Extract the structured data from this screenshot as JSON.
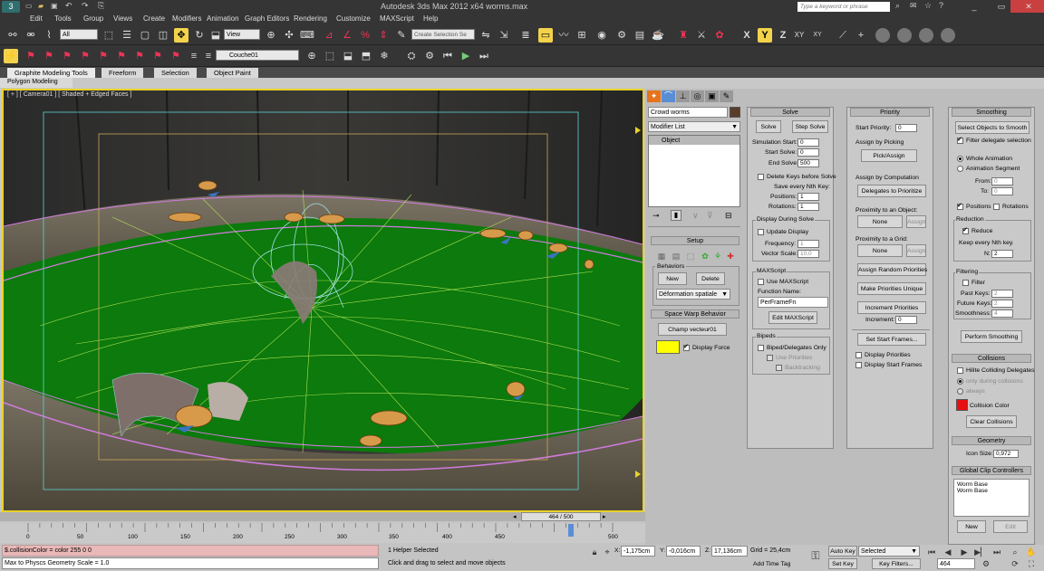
{
  "title_bar": {
    "title": "Autodesk 3ds Max  2012 x64      worms.max",
    "search_placeholder": "Type a keyword or phrase"
  },
  "menu": [
    "Edit",
    "Tools",
    "Group",
    "Views",
    "Create",
    "Modifiers",
    "Animation",
    "Graph Editors",
    "Rendering",
    "Customize",
    "MAXScript",
    "Help"
  ],
  "toolbar": {
    "filter_value": "All",
    "view_value": "View",
    "layer_value": "Couche01",
    "selection_set_placeholder": "Create Selection Se",
    "axis_x": "X",
    "axis_y": "Y",
    "axis_z": "Z",
    "axis_xy": "XY",
    "axis_xy2": "XY"
  },
  "ribbon": {
    "tabs": [
      "Graphite Modeling Tools",
      "Freeform",
      "Selection",
      "Object Paint"
    ],
    "sub_label": "Polygon Modeling"
  },
  "viewport": {
    "label": "[ + ] [ Camera01 ] [ Shaded + Edged Faces ]"
  },
  "modify": {
    "object_name": "Crowd worms",
    "modifier_list": "Modifier List",
    "stack_item": "Object"
  },
  "setup": {
    "header": "Setup",
    "behaviors_label": "Behaviors",
    "new": "New",
    "delete": "Delete",
    "behavior_value": "Déformation spatiale",
    "swb_header": "Space Warp Behavior",
    "swb_button": "Champ vecteur01",
    "display_force": "Display Force",
    "swatch_color": "#ffff00"
  },
  "solve": {
    "header": "Solve",
    "solve": "Solve",
    "step_solve": "Step Solve",
    "sim_start_label": "Simulation Start:",
    "sim_start": "0",
    "start_solve_label": "Start Solve:",
    "start_solve": "0",
    "end_solve_label": "End Solve:",
    "end_solve": "500",
    "delete_keys": "Delete Keys before Solve",
    "save_every": "Save every Nth Key:",
    "positions_label": "Positions:",
    "positions": "1",
    "rotations_label": "Rotations:",
    "rotations": "1",
    "display_during": "Display During Solve",
    "update_display": "Update Display",
    "frequency_label": "Frequency:",
    "frequency": "1",
    "vector_scale_label": "Vector Scale:",
    "vector_scale": "10,0",
    "maxscript": "MAXScript",
    "use_maxscript": "Use MAXScript",
    "function_name_label": "Function Name:",
    "function_name": "PerFrameFn",
    "edit_maxscript": "Edit MAXScript",
    "bipeds": "Bipeds",
    "biped_delegates": "Biped/Delegates Only",
    "use_priorities": "Use Priorities",
    "backtracking": "Backtracking"
  },
  "priority": {
    "header": "Priority",
    "start_priority_label": "Start Priority:",
    "start_priority": "0",
    "assign_by_picking": "Assign by Picking",
    "pick_assign": "Pick/Assign",
    "assign_by_computation": "Assign by Computation",
    "delegates_to_prioritize": "Delegates to Prioritize",
    "proximity_object": "Proximity to an Object:",
    "none1": "None",
    "assign1": "Assign",
    "proximity_grid": "Proximity to a Grid:",
    "none2": "None",
    "assign2": "Assign",
    "assign_random": "Assign Random Priorities",
    "make_unique": "Make Priorities Unique",
    "increment_priorities": "Increment Priorities",
    "increment_label": "Increment:",
    "increment": "0",
    "set_start_frames": "Set Start Frames...",
    "display_priorities": "Display Priorities",
    "display_start_frames": "Display Start Frames"
  },
  "smoothing": {
    "header": "Smoothing",
    "select_objects": "Select Objects to Smooth",
    "filter_delegate": "Filter delegate selection",
    "whole_animation": "Whole Animation",
    "animation_segment": "Animation Segment",
    "from_label": "From:",
    "from": "0",
    "to_label": "To:",
    "to": "0",
    "positions": "Positions",
    "rotations": "Rotations",
    "reduction": "Reduction",
    "reduce": "Reduce",
    "keep_every": "Keep every Nth key.",
    "n_label": "N:",
    "n": "2",
    "filtering": "Filtering",
    "filter": "Filter",
    "past_keys_label": "Past Keys:",
    "past_keys": "2",
    "future_keys_label": "Future Keys:",
    "future_keys": "2",
    "smoothness_label": "Smoothness:",
    "smoothness": "4",
    "perform_smoothing": "Perform Smoothing"
  },
  "collisions": {
    "header": "Collisions",
    "hilite": "Hilite Colliding Delegates",
    "only_during": "only during collisions",
    "always": "always",
    "collision_color_label": "Collision Color",
    "collision_color": "#e81010",
    "clear": "Clear Collisions"
  },
  "geometry": {
    "header": "Geometry",
    "icon_size_label": "Icon Size:",
    "icon_size": "0,972"
  },
  "clip": {
    "header": "Global Clip Controllers",
    "items": [
      "Worm Base",
      "Worm Base"
    ],
    "new": "New",
    "edit": "Edit"
  },
  "timeline": {
    "slider_label": "464 / 500",
    "ticks": [
      "0",
      "50",
      "100",
      "150",
      "200",
      "250",
      "300",
      "350",
      "400",
      "450",
      "500"
    ],
    "ruler_ticks": [
      0,
      50,
      100,
      150,
      200,
      250,
      300,
      350,
      400,
      450,
      500
    ],
    "current": 464,
    "max": 500
  },
  "status": {
    "script1": "$.collisionColor = color 255 0 0",
    "script2": "Max to Physcs Geometry Scale = 1.0",
    "selected": "1 Helper Selected",
    "prompt": "Click and drag to select and move objects",
    "x_label": "X:",
    "x": "-1,175cm",
    "y_label": "Y:",
    "y": "-0,016cm",
    "z_label": "Z:",
    "z": "17,136cm",
    "grid": "Grid = 25,4cm",
    "add_time_tag": "Add Time Tag",
    "auto_key": "Auto Key",
    "set_key": "Set Key",
    "selected_value": "Selected",
    "key_filters": "Key Filters...",
    "frame": "464"
  }
}
